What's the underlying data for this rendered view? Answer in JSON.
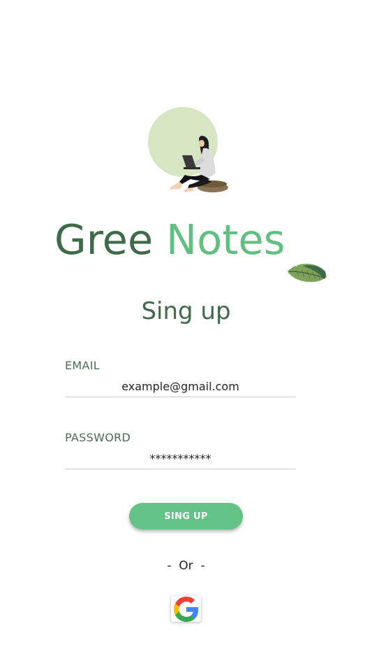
{
  "app": {
    "title_part_1": "Gree",
    "title_part_2": "Notes"
  },
  "heading": "Sing up",
  "form": {
    "email": {
      "label": "EMAIL",
      "value": "example@gmail.com"
    },
    "password": {
      "label": "PASSWORD",
      "value": "***********"
    }
  },
  "signup_button": "SING UP",
  "divider": "-  Or  -",
  "icons": {
    "illustration": "woman-with-laptop-illustration",
    "leaf": "leaf-icon",
    "google": "google-icon"
  },
  "colors": {
    "dark_green": "#3f6a49",
    "accent_green": "#63be82",
    "button_green": "#63c386",
    "circle_green": "#d6e6c3"
  }
}
